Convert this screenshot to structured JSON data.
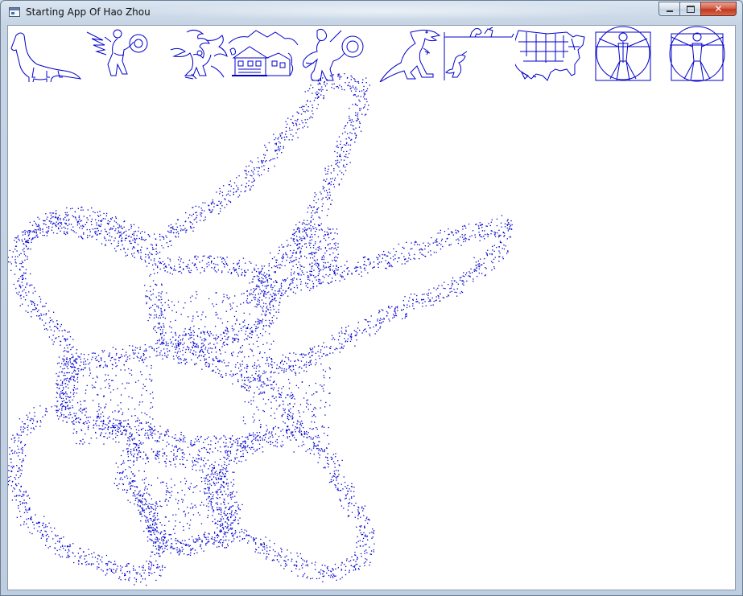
{
  "window": {
    "title": "Starting App Of Hao Zhou",
    "close_label": "✕"
  },
  "thumbnails": [
    {
      "name": "dinosaur",
      "label": "dinosaur"
    },
    {
      "name": "winged-warrior",
      "label": "winged warrior"
    },
    {
      "name": "dragon",
      "label": "dragon"
    },
    {
      "name": "house",
      "label": "house"
    },
    {
      "name": "warrior",
      "label": "warrior"
    },
    {
      "name": "t-rex",
      "label": "t-rex"
    },
    {
      "name": "rex-on-ledge",
      "label": "rex on ledge"
    },
    {
      "name": "usa-map",
      "label": "usa map"
    },
    {
      "name": "vitruvian-man",
      "label": "vitruvian man"
    },
    {
      "name": "vitruvian-man-circle",
      "label": "vitruvian man circle"
    }
  ],
  "drawing": {
    "shape": "dotted polyline figure",
    "color": "#0000d0"
  },
  "colors": {
    "stroke": "#0000cc",
    "close_button": "#c7412a"
  }
}
